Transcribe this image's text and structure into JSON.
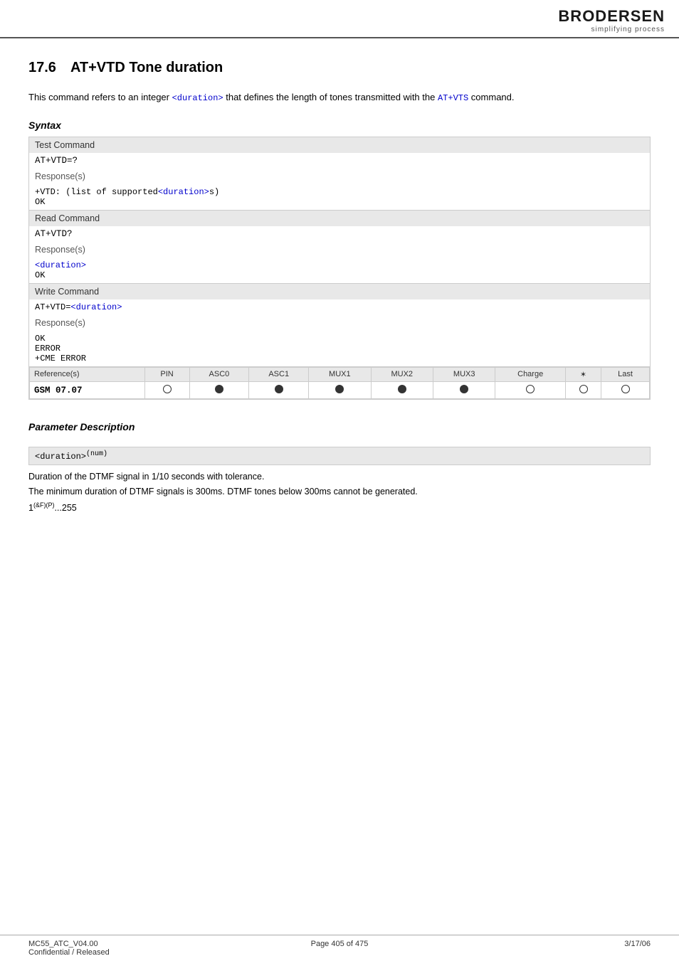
{
  "header": {
    "logo_main": "BRODERSEN",
    "logo_sub": "simplifying process"
  },
  "section": {
    "number": "17.6",
    "title": "AT+VTD   Tone duration"
  },
  "intro": {
    "text_before": "This command refers to an integer ",
    "param_code": "<duration>",
    "text_after": " that defines the length of tones transmitted with the ",
    "cmd_code": "AT+VTS",
    "text_end": " command."
  },
  "syntax": {
    "heading": "Syntax",
    "blocks": [
      {
        "header": "Test Command",
        "command": "AT+VTD=?",
        "response_label": "Response(s)",
        "response_lines": [
          "+VTD:  (list of supported<duration>s)",
          "OK"
        ]
      },
      {
        "header": "Read Command",
        "command": "AT+VTD?",
        "response_label": "Response(s)",
        "response_lines": [
          "<duration>",
          "OK"
        ]
      },
      {
        "header": "Write Command",
        "command": "AT+VTD=<duration>",
        "response_label": "Response(s)",
        "response_lines": [
          "OK",
          "ERROR",
          "+CME ERROR"
        ]
      }
    ]
  },
  "references": {
    "columns": [
      "PIN",
      "ASC0",
      "ASC1",
      "MUX1",
      "MUX2",
      "MUX3",
      "Charge",
      "⚙",
      "Last"
    ],
    "rows": [
      {
        "label": "GSM 07.07",
        "values": [
          "open",
          "filled",
          "filled",
          "filled",
          "filled",
          "filled",
          "open",
          "open",
          "open"
        ]
      }
    ]
  },
  "parameter_description": {
    "heading": "Parameter Description",
    "param": {
      "name": "<duration>",
      "superscript": "(num)"
    },
    "desc_lines": [
      "Duration of the DTMF signal in 1/10 seconds with tolerance.",
      "The minimum duration of DTMF signals is 300ms. DTMF tones below 300ms cannot be generated.",
      "1(&F)(P)...255"
    ]
  },
  "footer": {
    "left_line1": "MC55_ATC_V04.00",
    "left_line2": "Confidential / Released",
    "center": "Page 405 of 475",
    "right": "3/17/06"
  }
}
